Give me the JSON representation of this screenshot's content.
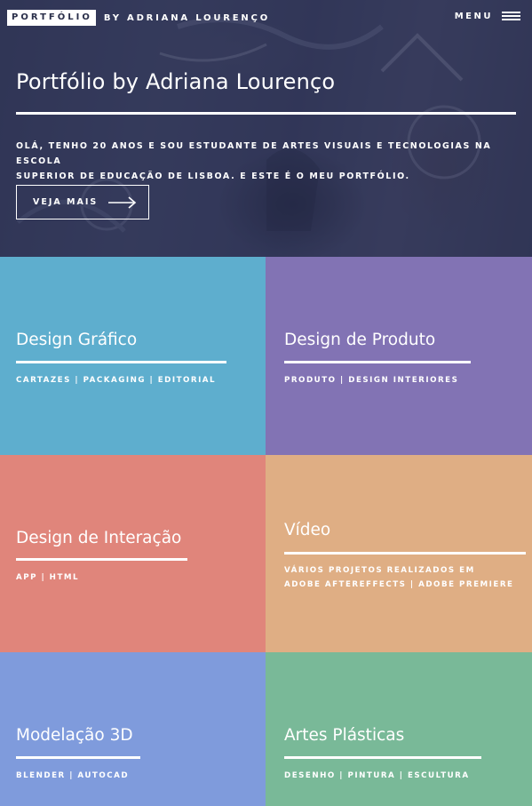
{
  "header": {
    "brand_box": "PORTFÓLIO",
    "brand_by": "BY ADRIANA LOURENÇO",
    "menu_label": "MENU"
  },
  "hero": {
    "title": "Portfólio by Adriana Lourenço",
    "intro_line1": "Olá, tenho 20 anos e sou estudante de Artes Visuais e Tecnologias na Escola",
    "intro_line2": "Superior de Educação de Lisboa. E este é o meu portfólio.",
    "button_label": "VEJA MAIS"
  },
  "tiles": [
    {
      "title": "Design Gráfico",
      "sub_line1": "Cartazes | Packaging | Editorial",
      "sub_line2": "",
      "color": "#5eaece"
    },
    {
      "title": "Design de Produto",
      "sub_line1": "Produto | Design Interiores",
      "sub_line2": "",
      "color": "#8273b4"
    },
    {
      "title": "Design de Interação",
      "sub_line1": "App | HTML",
      "sub_line2": "",
      "color": "#e0857b"
    },
    {
      "title": "Vídeo",
      "sub_line1": "Vários projetos realizados em",
      "sub_line2": "Adobe Aftereffects | Adobe Premiere",
      "color": "#dfae84"
    },
    {
      "title": "Modelação 3D",
      "sub_line1": "Blender | Autocad",
      "sub_line2": "",
      "color": "#7f9bdc"
    },
    {
      "title": "Artes Plásticas",
      "sub_line1": "Desenho | Pintura | Escultura",
      "sub_line2": "",
      "color": "#79b998"
    }
  ]
}
